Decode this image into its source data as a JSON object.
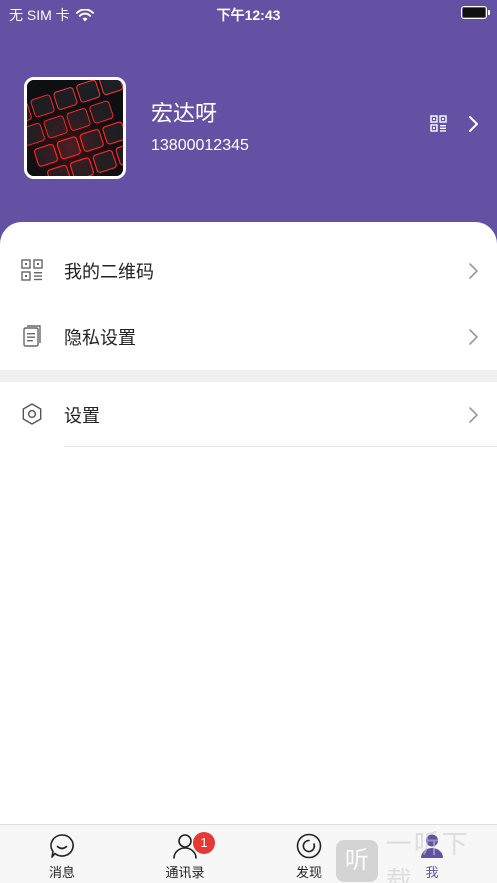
{
  "status_bar": {
    "carrier": "无 SIM 卡",
    "time": "下午12:43",
    "icons": [
      "wifi-icon",
      "battery-icon"
    ]
  },
  "profile": {
    "name": "宏达呀",
    "phone": "13800012345",
    "avatar_description": "keyboard-photo",
    "qr_icon": "qr-code-icon",
    "arrow_icon": "chevron-right-icon"
  },
  "menu": {
    "items": [
      {
        "label": "我的二维码",
        "icon": "qr-code-icon"
      },
      {
        "label": "隐私设置",
        "icon": "document-icon"
      }
    ],
    "settings": {
      "label": "设置",
      "icon": "hexagon-settings-icon"
    }
  },
  "tabbar": {
    "tabs": [
      {
        "label": "消息",
        "icon": "chat-bubble-icon",
        "active": false
      },
      {
        "label": "通讯录",
        "icon": "person-icon",
        "active": false,
        "badge": "1"
      },
      {
        "label": "发现",
        "icon": "compass-icon",
        "active": false
      },
      {
        "label": "我",
        "icon": "person-filled-icon",
        "active": true
      }
    ]
  },
  "watermark": {
    "logo_text": "听",
    "text": "一听下载"
  },
  "colors": {
    "header": "#6451a4",
    "accent": "#6451a4",
    "badge": "#e53935"
  }
}
